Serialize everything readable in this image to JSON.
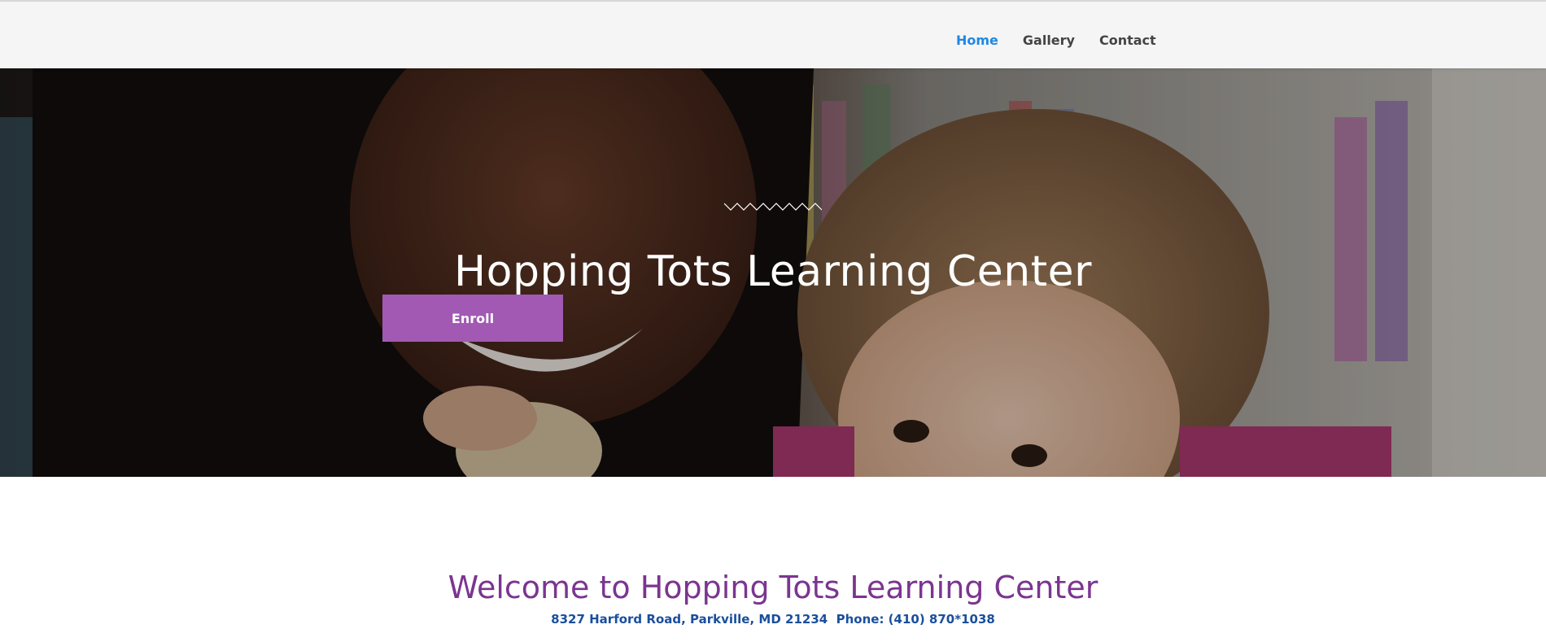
{
  "nav": {
    "items": [
      "Home",
      "Gallery",
      "Contact"
    ],
    "active": "Home"
  },
  "hero": {
    "title": "Hopping Tots Learning Center",
    "enroll_label": "Enroll",
    "button_color": "#a259b3"
  },
  "main": {
    "welcome": "Welcome to Hopping Tots Learning Center",
    "address_line": "8327 Harford Road, Parkville, MD 21234  Phone: (410) 870*1038"
  },
  "colors": {
    "nav_active": "#1e88e5",
    "welcome_heading": "#7b3590",
    "address_text": "#1a4f9c"
  }
}
